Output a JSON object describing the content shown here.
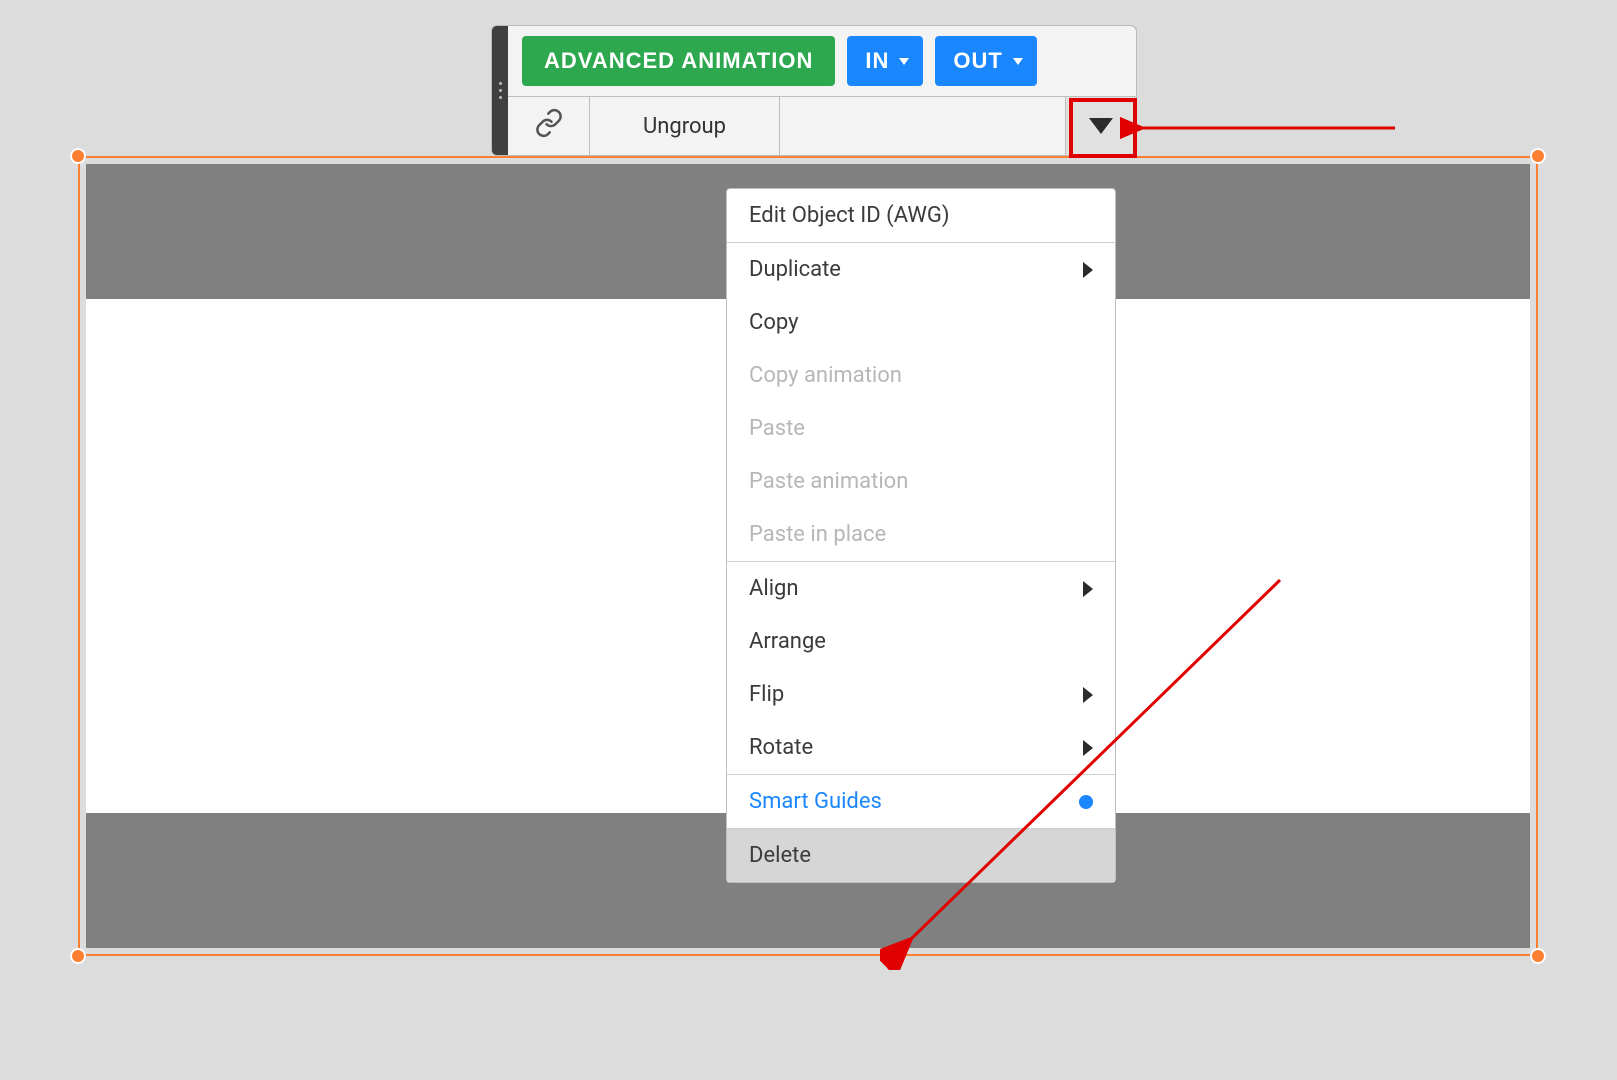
{
  "toolbar": {
    "advanced_label": "ADVANCED ANIMATION",
    "in_label": "IN",
    "out_label": "OUT",
    "ungroup_label": "Ungroup"
  },
  "menu": {
    "items": [
      {
        "label": "Edit Object ID (AWG)",
        "disabled": false,
        "submenu": false
      },
      {
        "separator": true
      },
      {
        "label": "Duplicate",
        "disabled": false,
        "submenu": true
      },
      {
        "label": "Copy",
        "disabled": false,
        "submenu": false
      },
      {
        "label": "Copy animation",
        "disabled": true,
        "submenu": false
      },
      {
        "label": "Paste",
        "disabled": true,
        "submenu": false
      },
      {
        "label": "Paste animation",
        "disabled": true,
        "submenu": false
      },
      {
        "label": "Paste in place",
        "disabled": true,
        "submenu": false
      },
      {
        "separator": true
      },
      {
        "label": "Align",
        "disabled": false,
        "submenu": true
      },
      {
        "label": "Arrange",
        "disabled": false,
        "submenu": false
      },
      {
        "label": "Flip",
        "disabled": false,
        "submenu": true
      },
      {
        "label": "Rotate",
        "disabled": false,
        "submenu": true
      },
      {
        "separator": true
      },
      {
        "label": "Smart Guides",
        "disabled": false,
        "submenu": false,
        "active_indicator": true
      },
      {
        "separator": true
      },
      {
        "label": "Delete",
        "disabled": false,
        "submenu": false,
        "hovered": true
      }
    ]
  }
}
